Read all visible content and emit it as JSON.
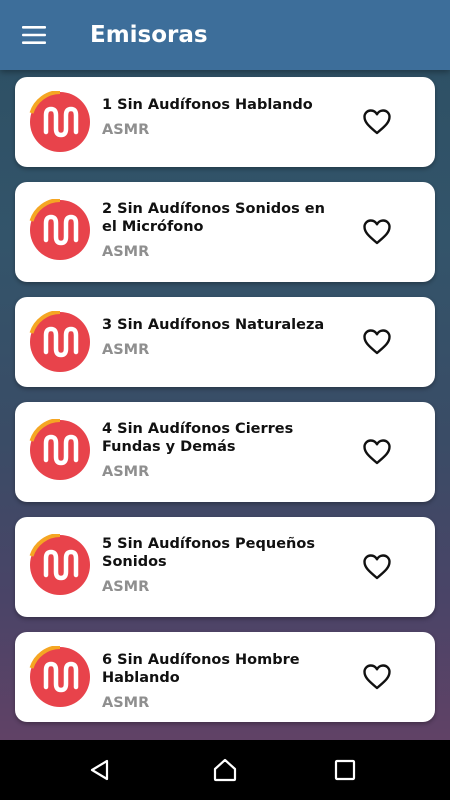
{
  "appbar": {
    "title": "Emisoras",
    "menu_icon": "hamburger-menu-icon",
    "background": "#3d6e9a"
  },
  "stations": [
    {
      "name": "1 Sin Audífonos Hablando",
      "genre": "ASMR",
      "logo_icon": "musically-logo-icon",
      "favorite_icon": "heart-outline-icon"
    },
    {
      "name": "2 Sin Audífonos Sonidos en el Micrófono",
      "genre": "ASMR",
      "logo_icon": "musically-logo-icon",
      "favorite_icon": "heart-outline-icon"
    },
    {
      "name": "3 Sin Audífonos Naturaleza",
      "genre": "ASMR",
      "logo_icon": "musically-logo-icon",
      "favorite_icon": "heart-outline-icon"
    },
    {
      "name": "4 Sin Audífonos Cierres Fundas y Demás",
      "genre": "ASMR",
      "logo_icon": "musically-logo-icon",
      "favorite_icon": "heart-outline-icon"
    },
    {
      "name": "5 Sin Audífonos Pequeños Sonidos",
      "genre": "ASMR",
      "logo_icon": "musically-logo-icon",
      "favorite_icon": "heart-outline-icon"
    },
    {
      "name": "6 Sin Audífonos Hombre Hablando",
      "genre": "ASMR",
      "logo_icon": "musically-logo-icon",
      "favorite_icon": "heart-outline-icon"
    }
  ],
  "navbar": {
    "back_icon": "back-triangle-icon",
    "home_icon": "home-icon",
    "recents_icon": "recents-square-icon"
  },
  "colors": {
    "logo_red": "#e8434b",
    "logo_ring": "#f5a623",
    "card_background": "#ffffff",
    "genre_text": "#8f8f8f"
  }
}
